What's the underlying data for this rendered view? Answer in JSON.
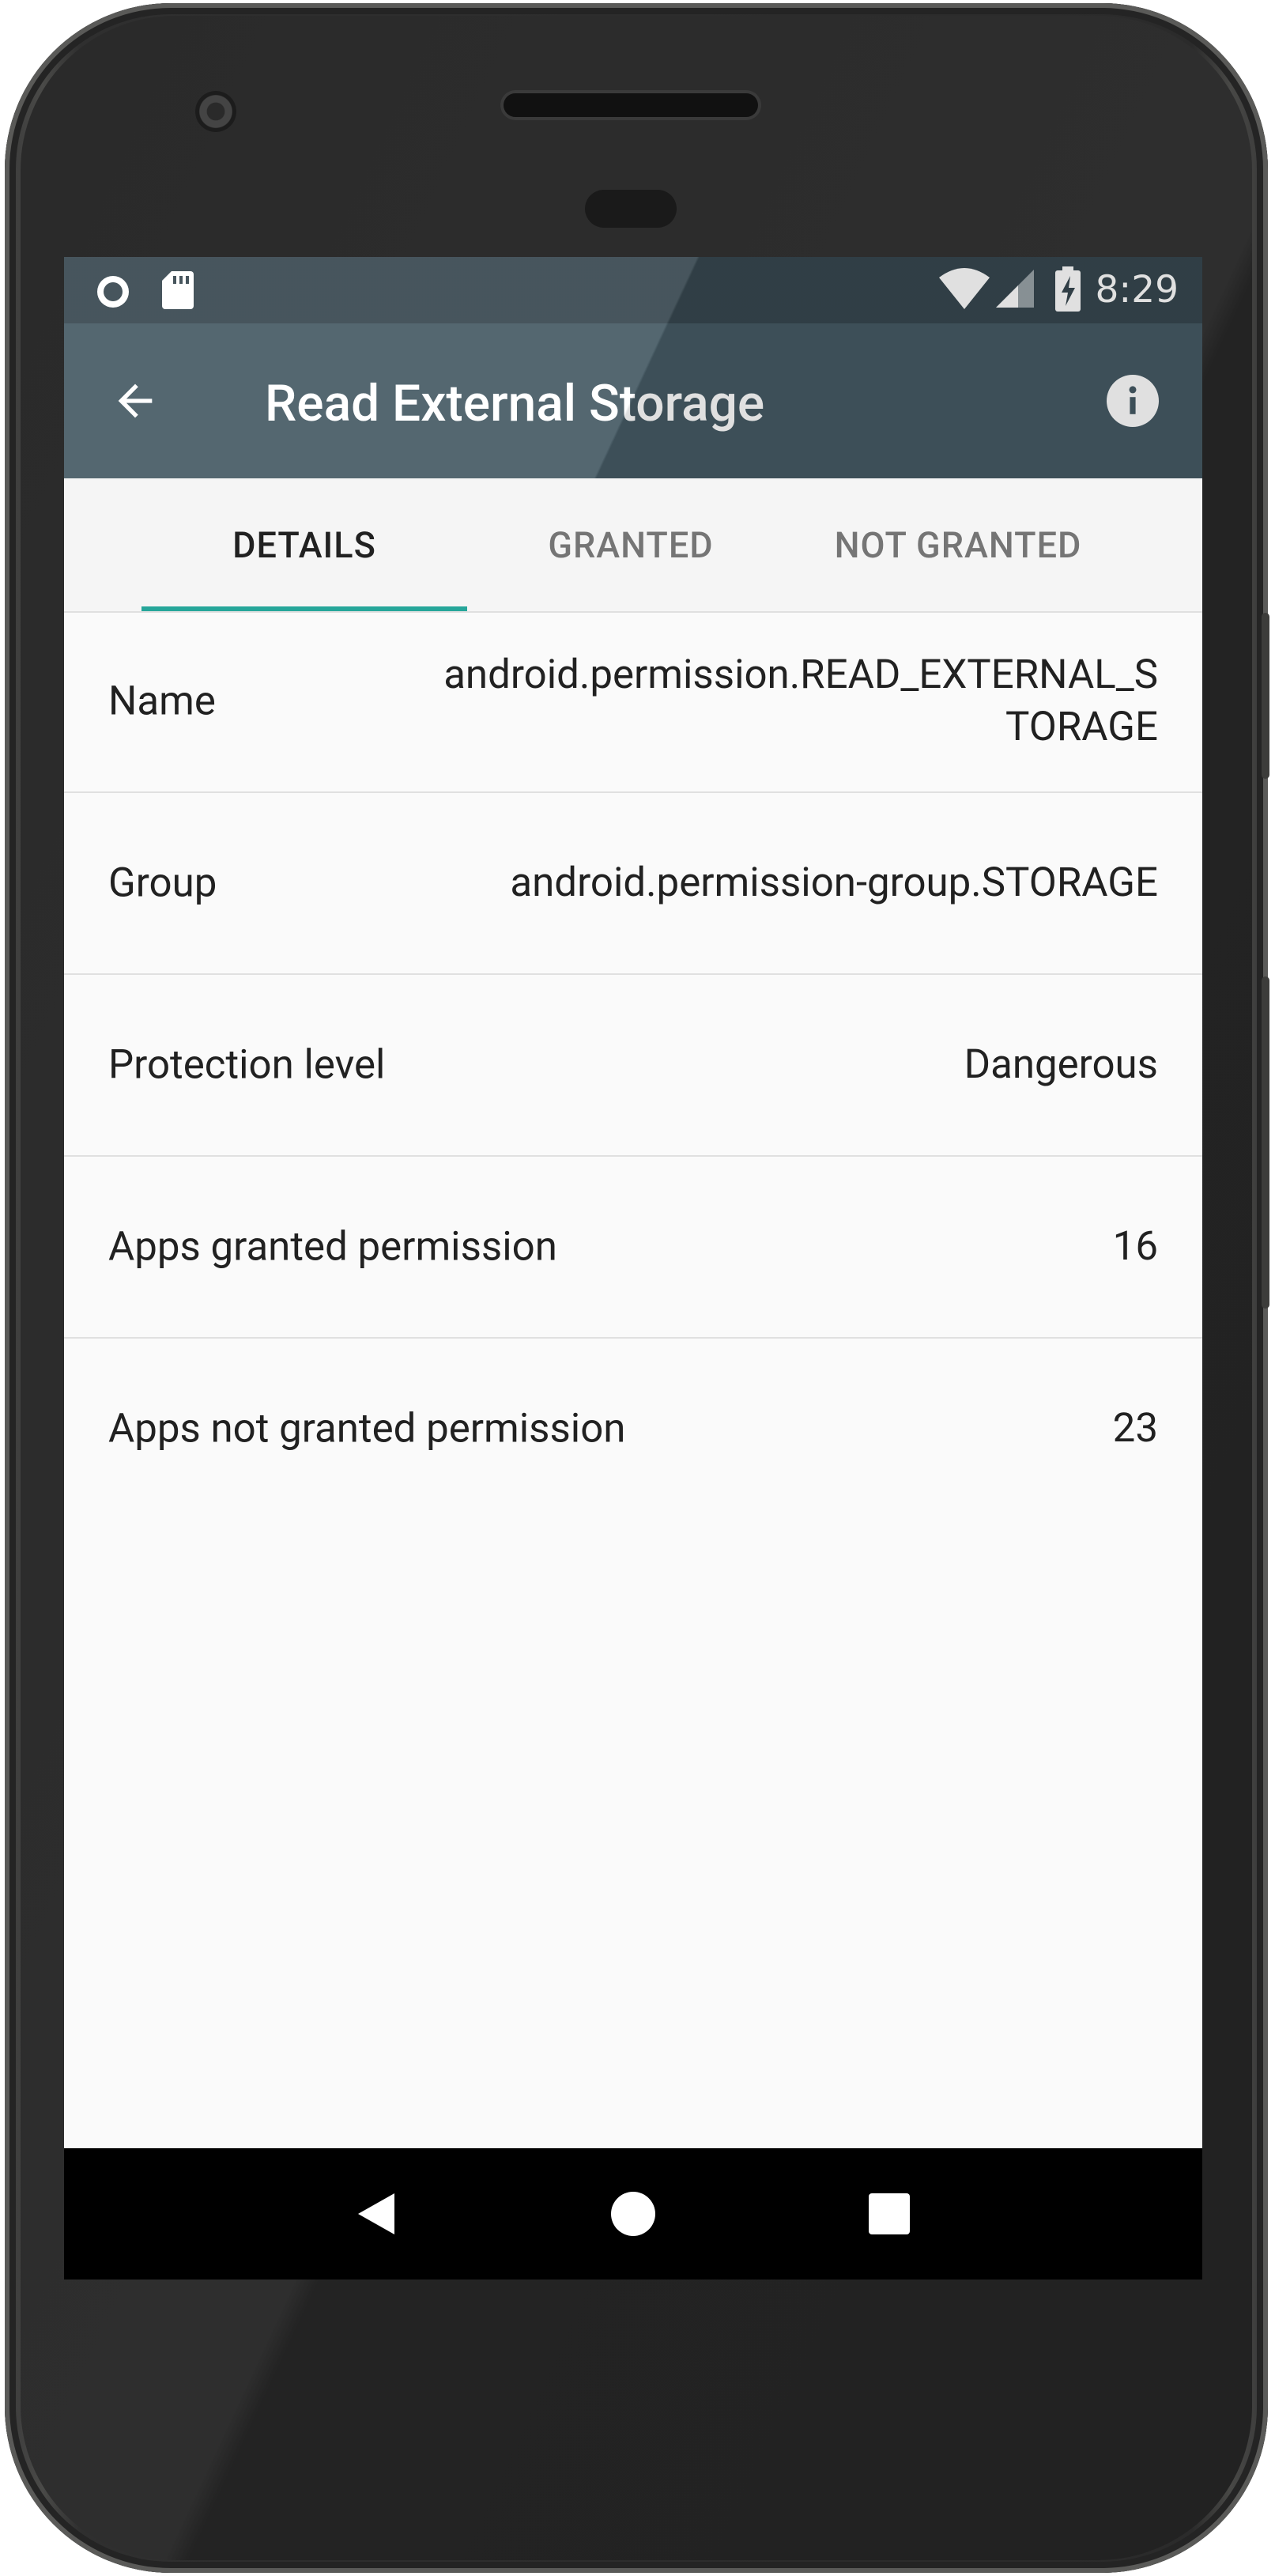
{
  "status_bar": {
    "time": "8:29",
    "left_icons": [
      "record-icon",
      "sd-card-icon"
    ],
    "right_icons": [
      "wifi-icon",
      "cell-signal-icon",
      "battery-charging-icon"
    ]
  },
  "app_bar": {
    "title": "Read External Storage",
    "back_icon": "arrow-back-icon",
    "info_icon": "info-icon",
    "color": "#455a64",
    "status_color": "#37474f"
  },
  "tabs": {
    "items": [
      {
        "label": "DETAILS",
        "active": true
      },
      {
        "label": "GRANTED",
        "active": false
      },
      {
        "label": "NOT GRANTED",
        "active": false
      }
    ],
    "indicator_color": "#26a69a"
  },
  "details": [
    {
      "label": "Name",
      "value": "android.permission.READ_EXTERNAL_STORAGE"
    },
    {
      "label": "Group",
      "value": "android.permission-group.STORAGE"
    },
    {
      "label": "Protection level",
      "value": "Dangerous"
    },
    {
      "label": "Apps granted permission",
      "value": "16"
    },
    {
      "label": "Apps not granted permission",
      "value": "23"
    }
  ],
  "nav_bar": {
    "buttons": [
      "back-triangle-icon",
      "home-circle-icon",
      "recents-square-icon"
    ]
  }
}
